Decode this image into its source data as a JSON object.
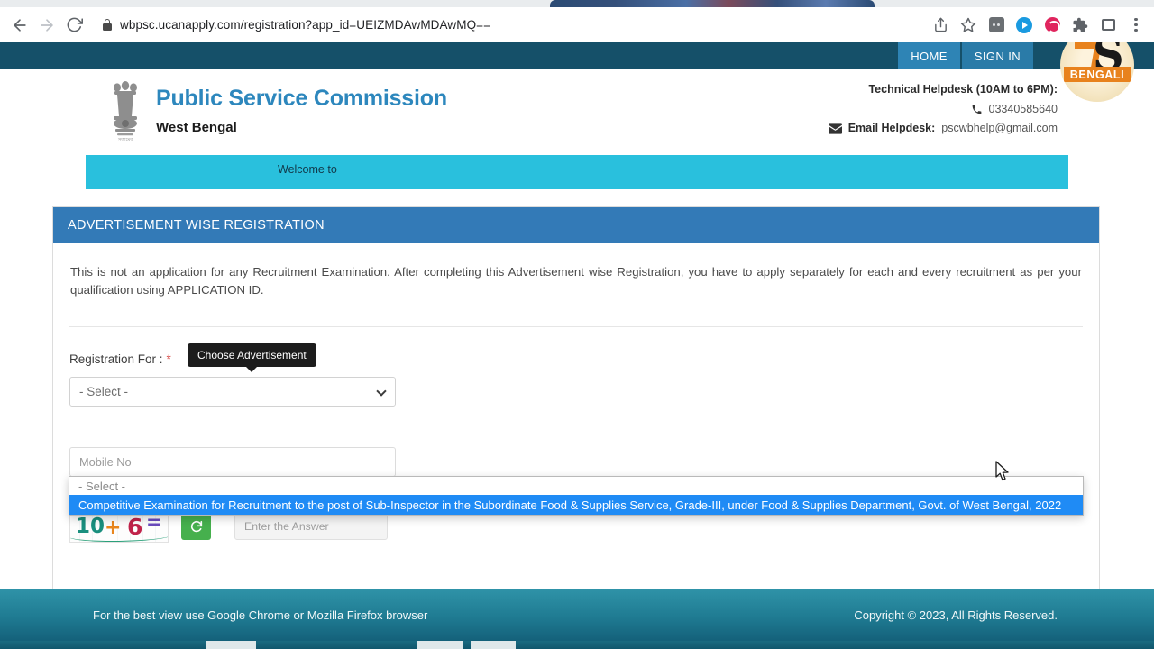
{
  "browser": {
    "url": "wbpsc.ucanapply.com/registration?app_id=UEIZMDAwMDAwMQ==",
    "back_icon": "back-arrow-icon",
    "forward_icon": "forward-arrow-icon",
    "reload_icon": "reload-icon",
    "lock_icon": "lock-icon",
    "toolbar_icons": [
      "share-icon",
      "bookmark-star-icon",
      "extension-grey-icon",
      "extension-blue-icon",
      "extension-red-icon",
      "puzzle-piece-icon",
      "window-icon",
      "kebab-menu-icon"
    ]
  },
  "topbar": {
    "home_label": "HOME",
    "signin_label": "SIGN IN",
    "badge": {
      "text": "BENGALI",
      "mark": "S"
    }
  },
  "header": {
    "brand_title": "Public Service Commission",
    "brand_sub": "West Bengal",
    "emblem_icon": "ashoka-emblem-icon",
    "helpdesk_title": "Technical Helpdesk (10AM to 6PM):",
    "phone_icon": "phone-icon",
    "phone": "03340585640",
    "email_icon": "envelope-icon",
    "email_label": "Email Helpdesk:",
    "email": "pscwbhelp@gmail.com"
  },
  "welcome_banner": {
    "text": "Welcome to"
  },
  "card": {
    "title": "ADVERTISEMENT WISE REGISTRATION",
    "intro": "This is not an application for any Recruitment Examination. After completing this Advertisement wise Registration, you have to apply separately for each and every recruitment as per your qualification using APPLICATION ID.",
    "registration_label": "Registration For :",
    "required_mark": "*",
    "tooltip": "Choose Advertisement",
    "select_value": "- Select -",
    "select_chevron_icon": "chevron-down-icon",
    "dropdown_options": [
      "- Select -",
      "Competitive Examination for Recruitment to the post of Sub-Inspector in the Subordinate Food & Supplies Service, Grade-III, under Food & Supplies Department, Govt. of West Bengal, 2022"
    ],
    "mobile_placeholder": "Mobile No",
    "mobile_value": "",
    "captcha": {
      "first": "10",
      "operator": "+",
      "second": "6",
      "equals": "=",
      "refresh_icon": "refresh-icon",
      "answer_placeholder": "Enter the Answer",
      "answer_value": ""
    }
  },
  "footer": {
    "left": "For the best view use Google Chrome or Mozilla Firefox browser",
    "right": "Copyright © 2023, All Rights Reserved."
  },
  "colors": {
    "topbar": "#155069",
    "brand_blue": "#2d87bd",
    "card_header": "#337ab7",
    "welcome_cyan": "#29c0dd",
    "highlight_blue": "#1f8bf5",
    "green_button": "#46b04d",
    "required_red": "#d9534f"
  }
}
